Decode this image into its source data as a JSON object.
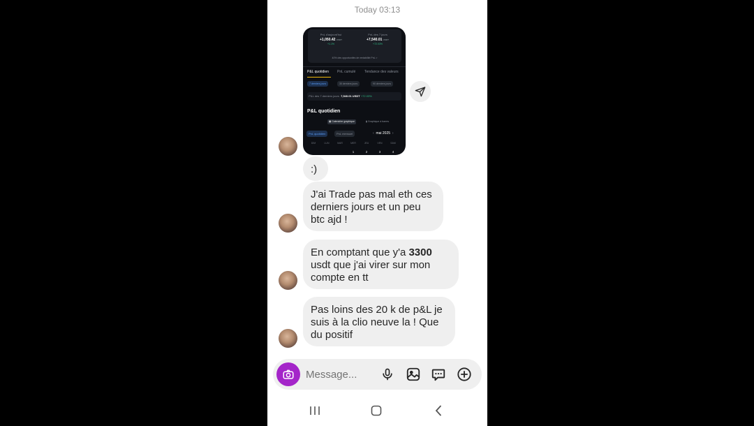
{
  "timestamp": "Today 03:13",
  "shared_screenshot": {
    "card_left_label": "PnL d'aujourd'hui",
    "card_left_value": "+1,050.42",
    "card_left_unit": "USDT",
    "card_left_pct": "+1.1%",
    "card_right_label": "PnL des 7 jours",
    "card_right_value": "+7,540.01",
    "card_right_unit": "USDT",
    "card_right_pct": "+72.03%",
    "card_footer": "40% des opportunités de rentabilité PnL  >",
    "tab_1": "P&L quotidien",
    "tab_2": "PnL cumulé",
    "tab_3": "Tendance des valeurs",
    "chip_1": "7 derniers jours",
    "chip_2": "30 derniers jours",
    "chip_3": "90 derniers jours",
    "pnl_label": "P&L des 7 derniers jours",
    "pnl_value": "7,540.01 USDT",
    "pnl_pct": "+72.03%",
    "section_title": "P&L quotidien",
    "graph_btn_1": "Calendrier graphique",
    "graph_btn_2": "Graphique à barres",
    "toggle_1": "PnL quotidien",
    "toggle_2": "PnL mensuel",
    "month": "mai 2025",
    "weekdays": [
      "DIM",
      "LUN",
      "MAR",
      "MER",
      "JEU",
      "VEN",
      "SAM"
    ],
    "days": [
      "1",
      "2",
      "3",
      "4"
    ]
  },
  "messages": [
    {
      "text": ":)"
    },
    {
      "text": "J'ai Trade pas mal eth ces derniers jours et un peu btc ajd !"
    },
    {
      "before": "En comptant que y'a ",
      "bold": "3300",
      "after": " usdt que j'ai virer sur mon compte en tt"
    },
    {
      "text": "Pas loins des 20 k de p&L je suis à la clio neuve la ! Que du positif"
    }
  ],
  "composer": {
    "placeholder": "Message...",
    "icons": [
      "camera-icon",
      "microphone-icon",
      "gallery-icon",
      "sticker-icon",
      "plus-icon"
    ]
  },
  "navbar": {
    "icons": [
      "recent-apps-icon",
      "home-icon",
      "back-icon"
    ]
  }
}
